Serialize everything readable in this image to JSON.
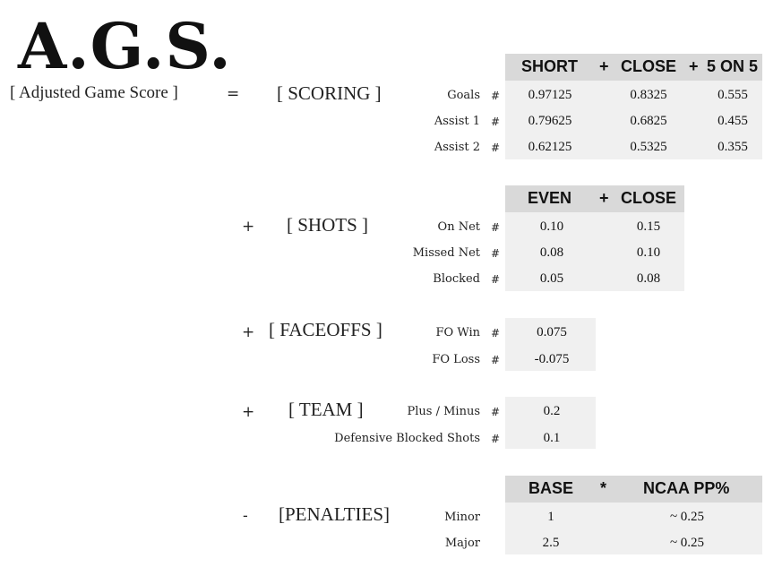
{
  "title": "A.G.S.",
  "subtitle": "[ Adjusted Game Score ]",
  "equals": "=",
  "scoring": {
    "label": "[ SCORING ]",
    "headers": [
      "SHORT",
      "+",
      "CLOSE",
      "+",
      "5 ON 5"
    ],
    "rows": [
      {
        "label": "Goals",
        "hash": "#",
        "values": [
          "0.97125",
          "0.8325",
          "0.555"
        ]
      },
      {
        "label": "Assist 1",
        "hash": "#",
        "values": [
          "0.79625",
          "0.6825",
          "0.455"
        ]
      },
      {
        "label": "Assist 2",
        "hash": "#",
        "values": [
          "0.62125",
          "0.5325",
          "0.355"
        ]
      }
    ]
  },
  "shots": {
    "op": "+",
    "label": "[ SHOTS ]",
    "headers": [
      "EVEN",
      "+",
      "CLOSE"
    ],
    "rows": [
      {
        "label": "On Net",
        "hash": "#",
        "values": [
          "0.10",
          "0.15"
        ]
      },
      {
        "label": "Missed Net",
        "hash": "#",
        "values": [
          "0.08",
          "0.10"
        ]
      },
      {
        "label": "Blocked",
        "hash": "#",
        "values": [
          "0.05",
          "0.08"
        ]
      }
    ]
  },
  "faceoffs": {
    "op": "+",
    "label": "[ FACEOFFS ]",
    "rows": [
      {
        "label": "FO Win",
        "hash": "#",
        "value": "0.075"
      },
      {
        "label": "FO Loss",
        "hash": "#",
        "value": "-0.075"
      }
    ]
  },
  "team": {
    "op": "+",
    "label": "[ TEAM ]",
    "rows": [
      {
        "label": "Plus / Minus",
        "hash": "#",
        "value": "0.2"
      },
      {
        "label": "Defensive Blocked Shots",
        "hash": "#",
        "value": "0.1"
      }
    ]
  },
  "penalties": {
    "op": "-",
    "label": "[PENALTIES]",
    "headers": [
      "BASE",
      "*",
      "NCAA PP%"
    ],
    "rows": [
      {
        "label": "Minor",
        "values": [
          "1",
          "~ 0.25"
        ]
      },
      {
        "label": "Major",
        "values": [
          "2.5",
          "~ 0.25"
        ]
      }
    ]
  }
}
